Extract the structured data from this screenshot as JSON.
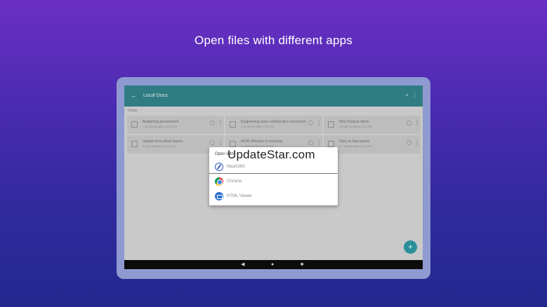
{
  "headline": "Open files with different apps",
  "app": {
    "title": "Local Docs",
    "section": "Today"
  },
  "files": [
    {
      "name": "Budgeting spreadsheet",
      "meta": "1.93 MB Modified 10:45 AM"
    },
    {
      "name": "Engineering team collaboration document",
      "meta": "1.05 MB Modified 9:30 AM"
    },
    {
      "name": "New Product demo",
      "meta": "5.6 MB Modified 11:02 AM"
    },
    {
      "name": "Update from whole teams",
      "meta": "0.8 MB Modified 10:33 AM"
    },
    {
      "name": "MOM (Minutes of meeting)",
      "meta": "0.3 MB Modified 08:25 AM"
    },
    {
      "name": "Data on last quarter",
      "meta": "2.1 MB Modified 08:02 AM"
    }
  ],
  "dialog": {
    "title": "Open with",
    "watermark": "UpdateStar.com",
    "options": [
      {
        "label": "MaaS360",
        "icon": "maas360-icon"
      },
      {
        "label": "Chrome",
        "icon": "chrome-icon"
      },
      {
        "label": "HTML Viewer",
        "icon": "html-viewer-icon"
      }
    ]
  },
  "icons": {
    "back": "←",
    "search": "⌕",
    "more": "⋮",
    "fab": "+",
    "nav_back": "◀",
    "nav_home": "●",
    "nav_recents": "■"
  },
  "colors": {
    "app_bar": "#2f7d83",
    "fab": "#2a8f98",
    "background_top": "#6b2fc4",
    "background_bottom": "#24288f"
  }
}
